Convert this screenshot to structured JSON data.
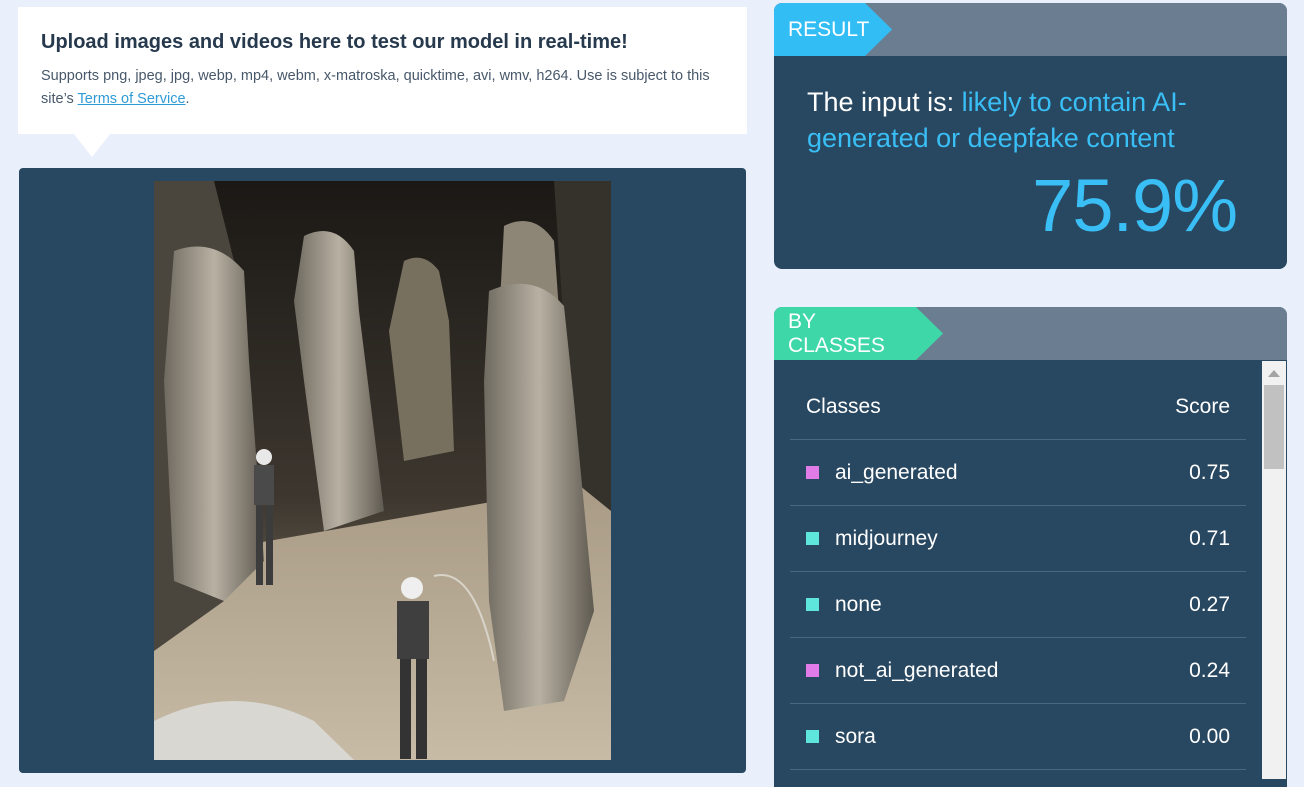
{
  "upload": {
    "title": "Upload images and videos here to test our model in real-time!",
    "desc_prefix": "Supports png, jpeg, jpg, webp, mp4, webm, x-matroska, quicktime, avi, wmv, h264. Use is subject to this site’s ",
    "tos_link": "Terms of Service",
    "desc_suffix": "."
  },
  "result": {
    "tag": "RESULT",
    "prefix": "The input is: ",
    "verdict": "likely to contain AI-generated or deepfake content",
    "percent": "75.9%"
  },
  "classes": {
    "tag": "BY CLASSES",
    "header_class": "Classes",
    "header_score": "Score",
    "rows": [
      {
        "name": "ai_generated",
        "score": "0.75",
        "color": "#e07be8"
      },
      {
        "name": "midjourney",
        "score": "0.71",
        "color": "#5ee6dc"
      },
      {
        "name": "none",
        "score": "0.27",
        "color": "#5ee6dc"
      },
      {
        "name": "not_ai_generated",
        "score": "0.24",
        "color": "#e07be8"
      },
      {
        "name": "sora",
        "score": "0.00",
        "color": "#5ee6dc"
      }
    ]
  },
  "colors": {
    "accent_blue": "#33bdf5",
    "accent_green": "#3ed7a8",
    "panel": "#284760"
  }
}
